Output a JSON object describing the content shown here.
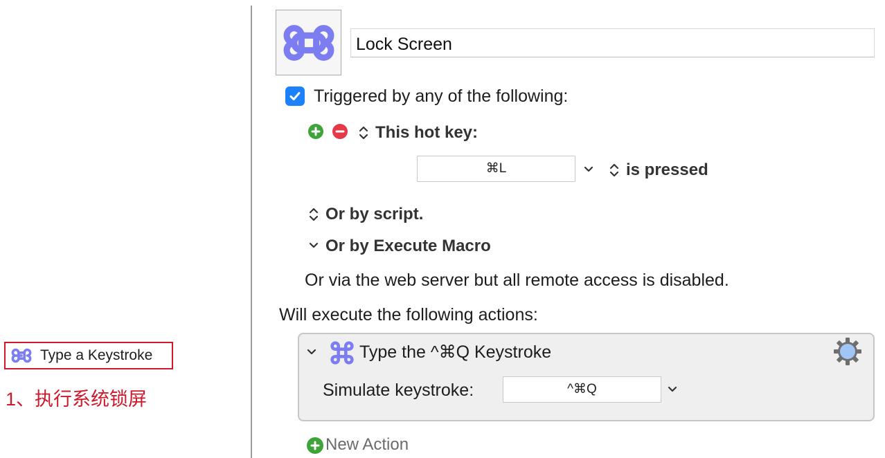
{
  "left_panel": {
    "action_label": "Type a Keystroke",
    "note": "1、执行系统锁屏"
  },
  "macro": {
    "name": "Lock Screen",
    "icon": "command-icon"
  },
  "trigger": {
    "enabled": true,
    "header": "Triggered by any of the following:",
    "hotkey_label": "This hot key:",
    "hotkey_value": "⌘L",
    "hotkey_condition": "is pressed",
    "script_label": "Or by script.",
    "execute_macro_label": "Or by Execute Macro",
    "web_server_note": "Or via the web server but all remote access is disabled."
  },
  "actions": {
    "header": "Will execute the following actions:",
    "items": [
      {
        "title": "Type the ^⌘Q Keystroke",
        "field_label": "Simulate keystroke:",
        "keystroke": "^⌘Q"
      }
    ],
    "new_action_label": "New Action"
  },
  "colors": {
    "accent_blue": "#1b82fb",
    "command_icon": "#7d7df2",
    "annotation_red": "#d0182a",
    "add_green": "#3ea43a",
    "remove_red": "#e53848",
    "gear_blue": "#9fc6f5"
  }
}
